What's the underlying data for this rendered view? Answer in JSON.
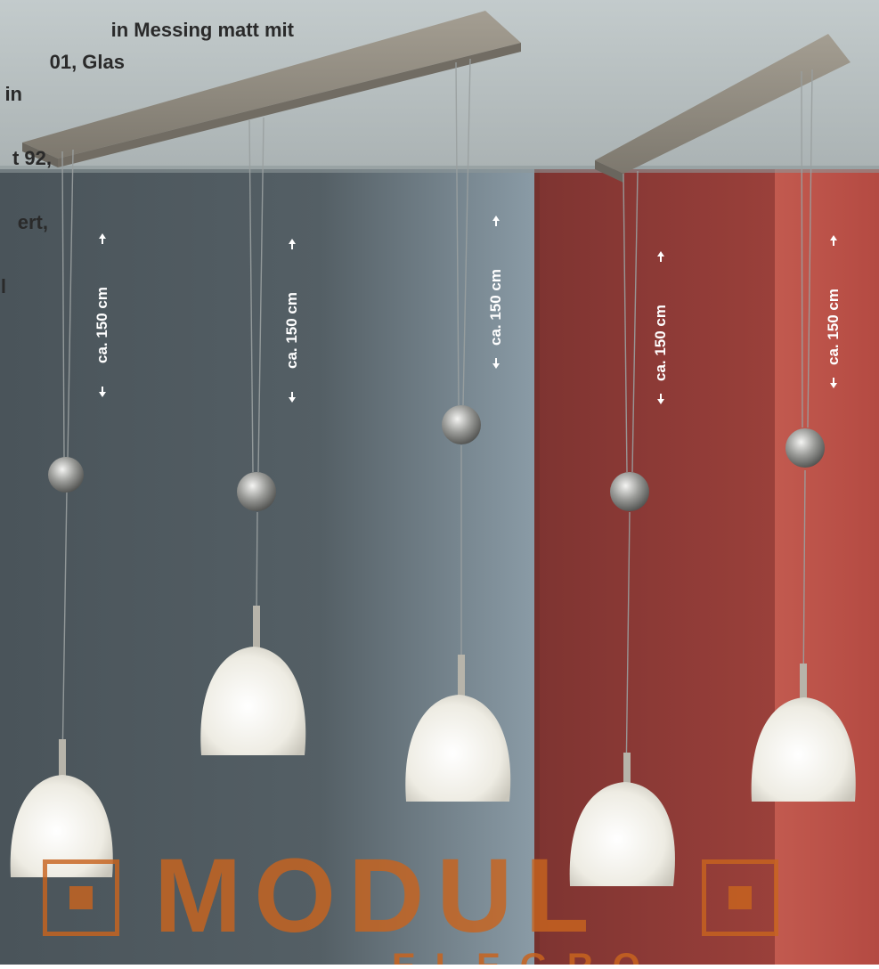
{
  "description_lines": [
    "in Messing matt mit",
    "01, Glas",
    "in",
    "",
    "t 92,",
    "",
    "ert,",
    "",
    "l"
  ],
  "dimension_label": "ca. 150 cm",
  "logo": {
    "text": "MODUL",
    "subtext": "ELEGRO",
    "color": "#c8641f"
  },
  "colors": {
    "wall_left": "#4f5a60",
    "wall_red": "#8c3a36",
    "ceiling": "#b9c2c4",
    "glass": "#f1efe8"
  }
}
